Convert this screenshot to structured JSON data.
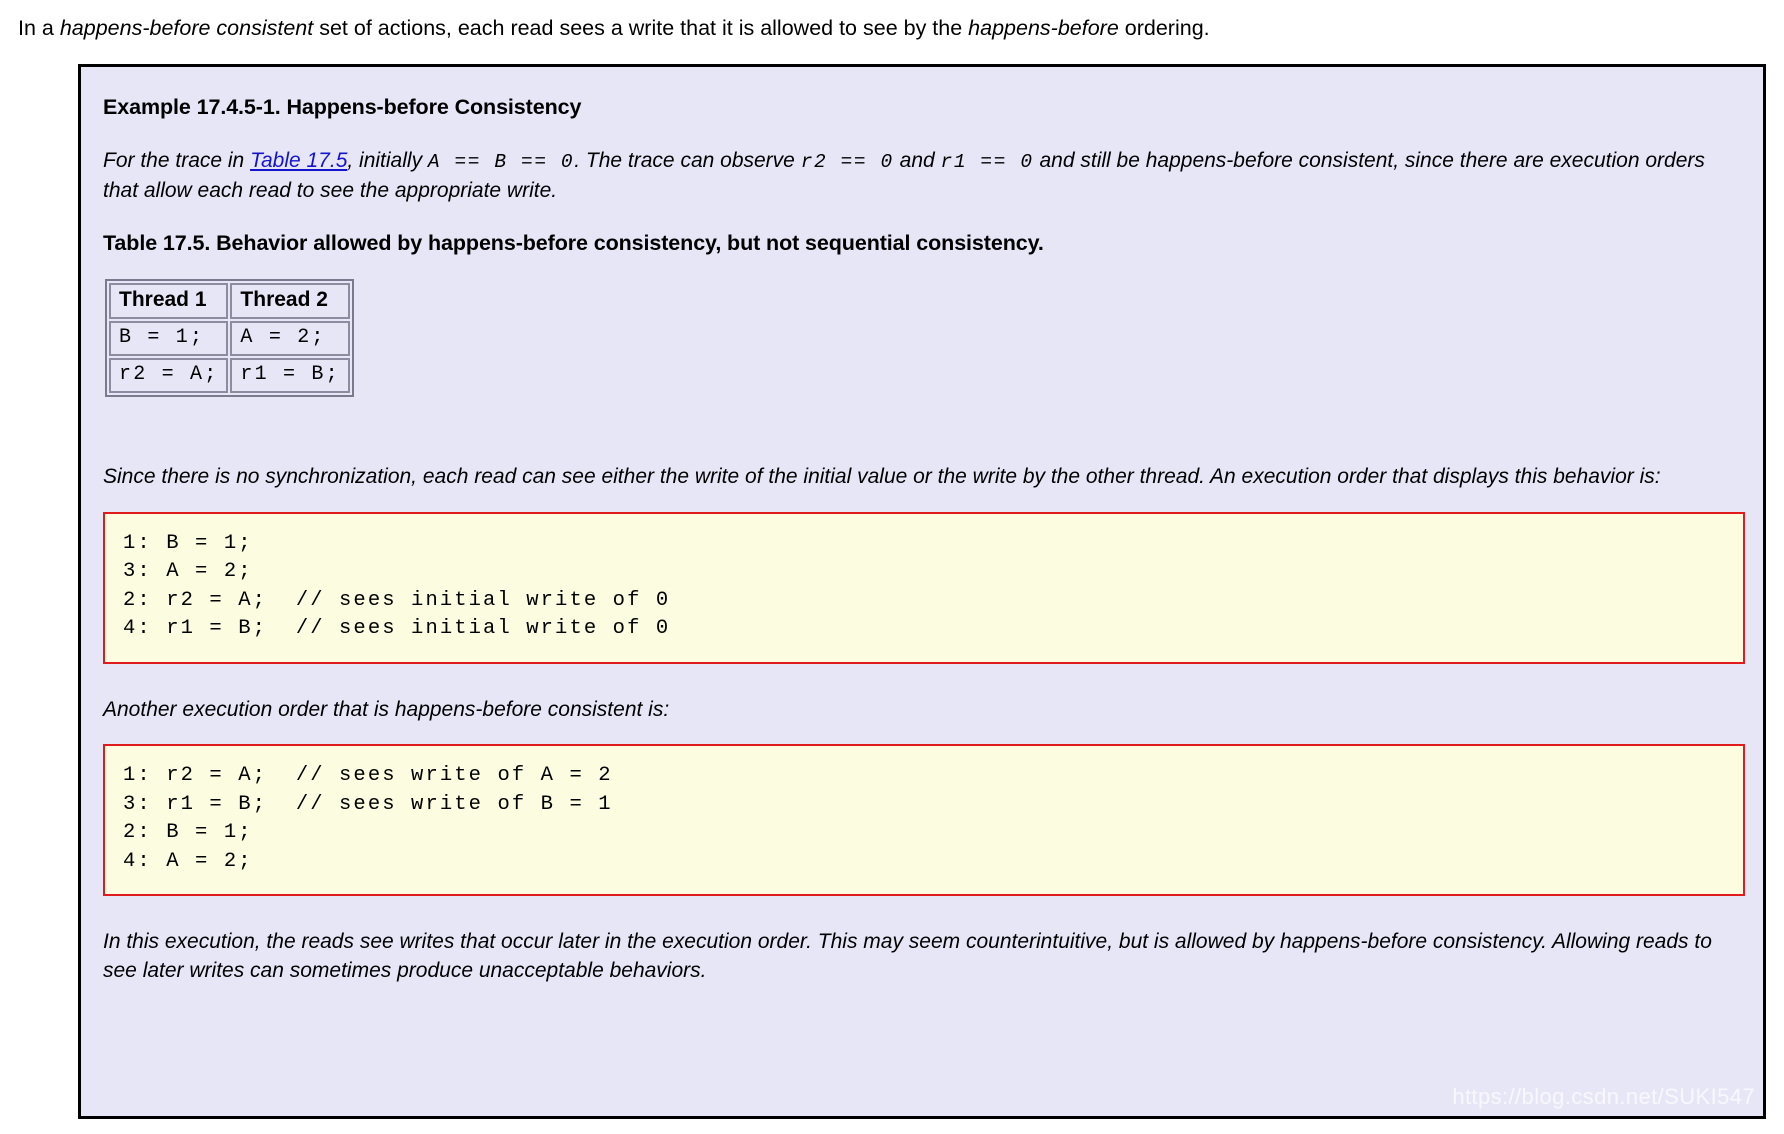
{
  "intro": {
    "part1": "In a ",
    "emphasis1": "happens-before consistent",
    "part2": " set of actions, each read sees a write that it is allowed to see by the ",
    "emphasis2": "happens-before",
    "part3": " ordering."
  },
  "example": {
    "title": "Example 17.4.5-1. Happens-before Consistency",
    "intro_para": {
      "seg1": "For the trace in ",
      "link": "Table 17.5",
      "seg2": ", initially ",
      "code1": "A == B == 0",
      "seg3": ". The trace can observe ",
      "code2": "r2 == 0",
      "seg4": " and ",
      "code3": "r1 == 0",
      "seg5": " and still be happens-before consistent, since there are execution orders that allow each read to see the appropriate write."
    },
    "table_caption": "Table 17.5. Behavior allowed by happens-before consistency, but not sequential consistency.",
    "table": {
      "headers": [
        "Thread 1",
        "Thread 2"
      ],
      "rows": [
        [
          "B = 1;",
          "A = 2;"
        ],
        [
          "r2 = A;",
          "r1 = B;"
        ]
      ]
    },
    "para_before_code1": "Since there is no synchronization, each read can see either the write of the initial value or the write by the other thread. An execution order that displays this behavior is:",
    "code_block_1": "1: B = 1;\n3: A = 2;\n2: r2 = A;  // sees initial write of 0\n4: r1 = B;  // sees initial write of 0",
    "para_before_code2": "Another execution order that is happens-before consistent is:",
    "code_block_2": "1: r2 = A;  // sees write of A = 2\n3: r1 = B;  // sees write of B = 1\n2: B = 1;\n4: A = 2;",
    "closing_para": "In this execution, the reads see writes that occur later in the execution order. This may seem counterintuitive, but is allowed by happens-before consistency. Allowing reads to see later writes can sometimes produce unacceptable behaviors."
  },
  "watermark": "https://blog.csdn.net/SUKI547",
  "colors": {
    "box_background": "#e6e6f7",
    "box_border": "#000000",
    "code_background": "#fcfce0",
    "code_border": "#e01b1b",
    "link": "#1414cc"
  }
}
